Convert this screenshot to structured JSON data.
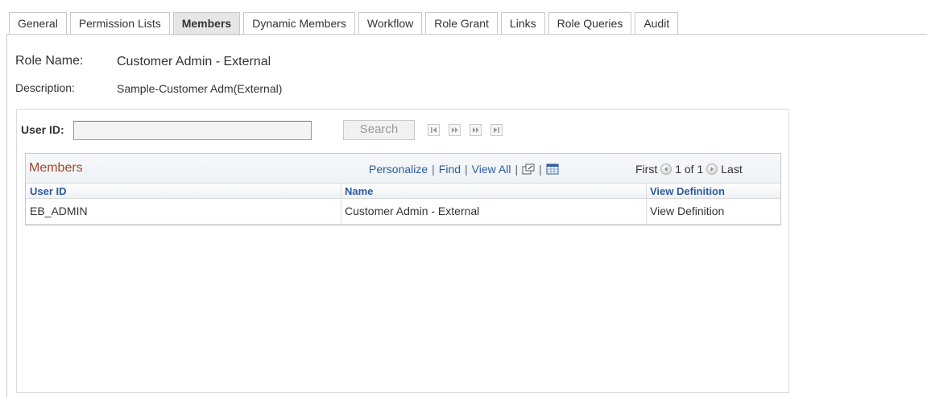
{
  "tabs": [
    {
      "label": "General",
      "active": false
    },
    {
      "label": "Permission Lists",
      "active": false
    },
    {
      "label": "Members",
      "active": true
    },
    {
      "label": "Dynamic Members",
      "active": false
    },
    {
      "label": "Workflow",
      "active": false
    },
    {
      "label": "Role Grant",
      "active": false
    },
    {
      "label": "Links",
      "active": false
    },
    {
      "label": "Role Queries",
      "active": false
    },
    {
      "label": "Audit",
      "active": false
    }
  ],
  "role": {
    "name_label": "Role Name:",
    "name_value": "Customer Admin - External",
    "description_label": "Description:",
    "description_value": "Sample-Customer Adm(External)"
  },
  "search": {
    "user_id_label": "User ID:",
    "user_id_value": "",
    "search_button": "Search"
  },
  "grid": {
    "title": "Members",
    "personalize": "Personalize",
    "find": "Find",
    "view_all": "View All",
    "sep": "|",
    "first": "First",
    "range": "1 of 1",
    "last": "Last",
    "columns": [
      "User ID",
      "Name",
      "View Definition"
    ],
    "rows": [
      {
        "user_id": "EB_ADMIN",
        "name": "Customer Admin - External",
        "view_definition": "View Definition"
      }
    ]
  },
  "colors": {
    "tab_active_bg": "#e6e6e6",
    "grid_title": "#9c4a2d",
    "link": "#2e5c9a"
  }
}
